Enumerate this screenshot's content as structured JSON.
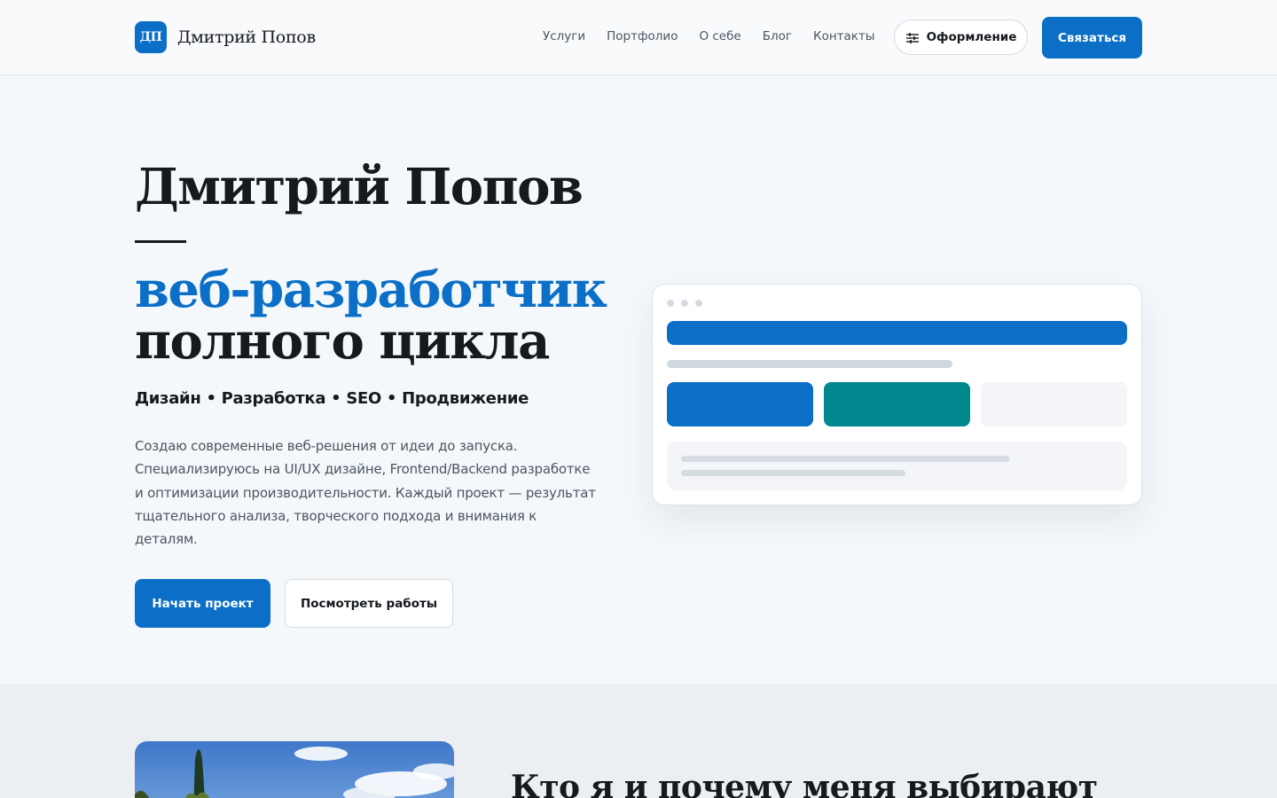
{
  "header": {
    "logo_mark": "ДП",
    "logo_text": "Дмитрий Попов",
    "nav": [
      "Услуги",
      "Портфолио",
      "О себе",
      "Блог",
      "Контакты"
    ],
    "theme_button": "Оформление",
    "theme_icon": "sliders-icon",
    "contact_button": "Связаться"
  },
  "hero": {
    "name": "Дмитрий Попов",
    "title_accent": "веб-разработчик",
    "title_rest": "полного цикла",
    "tagline": "Дизайн • Разработка • SEO • Продвижение",
    "description": "Создаю современные веб-решения от идеи до запуска. Специализируюсь на UI/UX дизайне, Frontend/Backend разработке и оптимизации производительности. Каждый проект — результат тщательного анализа, творческого подхода и внимания к деталям.",
    "primary_button": "Начать проект",
    "secondary_button": "Посмотреть работы"
  },
  "about": {
    "title": "Кто я и почему меня выбирают"
  },
  "colors": {
    "accent": "#0b6fc7",
    "teal": "#00888f",
    "text": "#16191d",
    "muted": "#4b5560",
    "background": "#f4f8fb"
  }
}
